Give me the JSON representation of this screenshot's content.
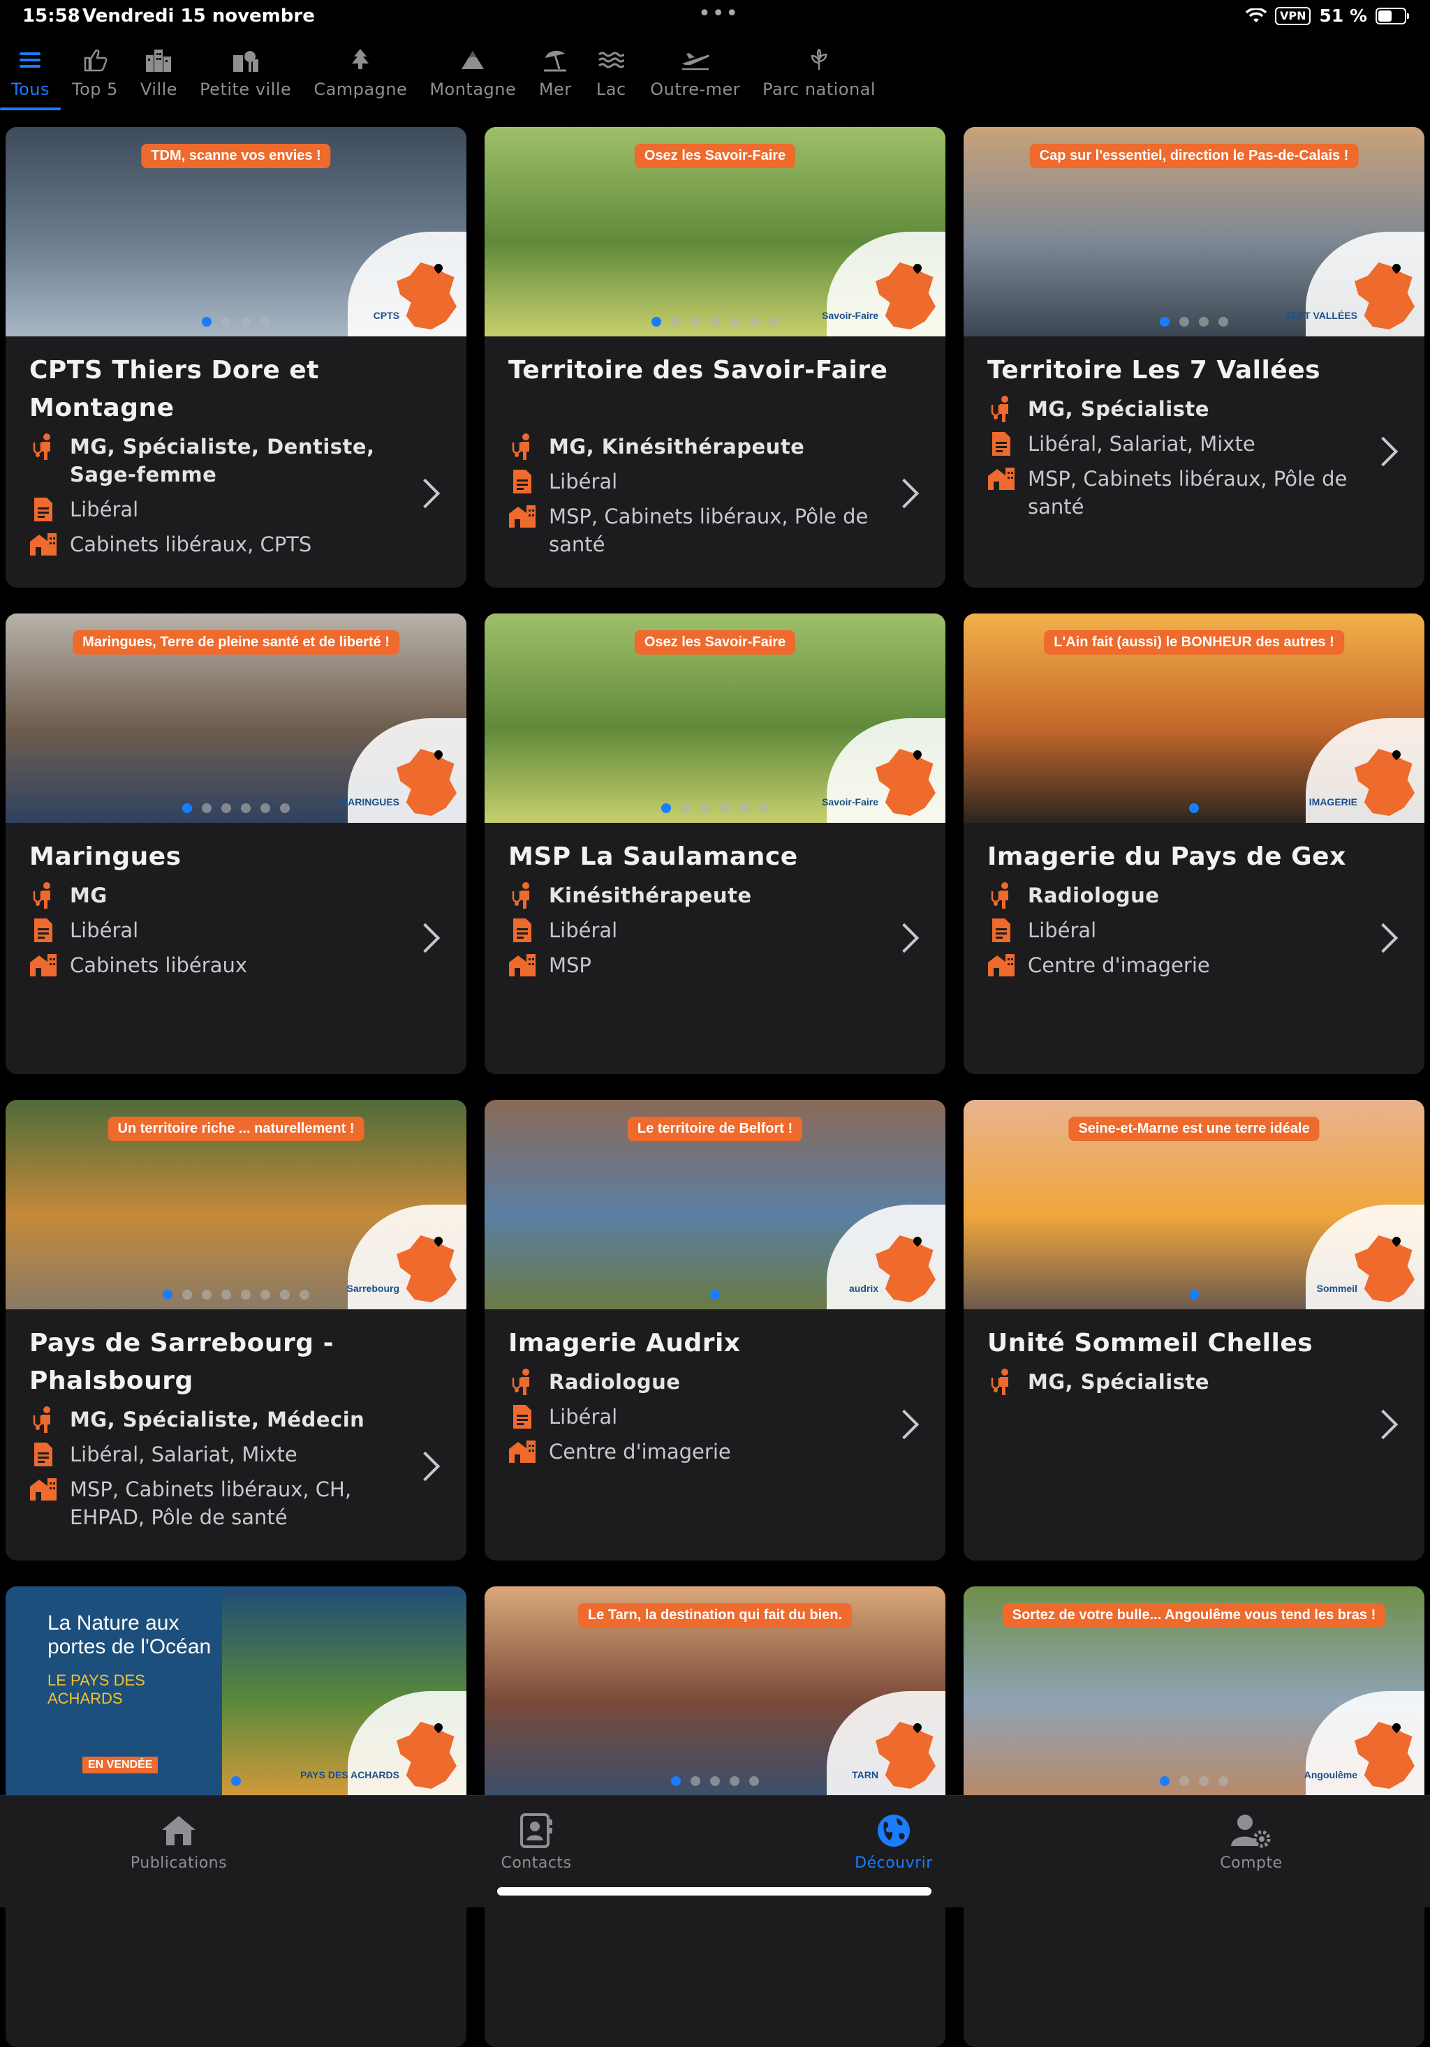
{
  "status": {
    "time": "15:58",
    "date": "Vendredi 15 novembre",
    "vpn": "VPN",
    "battery": "51 %"
  },
  "categories": [
    {
      "label": "Tous",
      "icon": "menu-icon",
      "active": true
    },
    {
      "label": "Top 5",
      "icon": "thumbs-up-icon"
    },
    {
      "label": "Ville",
      "icon": "city-icon"
    },
    {
      "label": "Petite ville",
      "icon": "small-town-icon"
    },
    {
      "label": "Campagne",
      "icon": "tree-icon"
    },
    {
      "label": "Montagne",
      "icon": "mountain-icon"
    },
    {
      "label": "Mer",
      "icon": "beach-umbrella-icon"
    },
    {
      "label": "Lac",
      "icon": "waves-icon"
    },
    {
      "label": "Outre-mer",
      "icon": "plane-icon"
    },
    {
      "label": "Parc national",
      "icon": "plant-icon"
    }
  ],
  "cards": [
    {
      "banner": "TDM, scanne vos envies !",
      "logo": "CPTS",
      "dots": 4,
      "active_dot": 0,
      "title": "CPTS Thiers Dore et Montagne",
      "specialties": "MG, Spécialiste, Dentiste, Sage-femme",
      "practice": "Libéral",
      "structures": "Cabinets libéraux, CPTS",
      "colors": [
        "#3d4a5a",
        "#6b7d8f",
        "#a8b6c4"
      ]
    },
    {
      "banner": "Osez les Savoir-Faire",
      "logo": "Savoir-Faire",
      "dots": 7,
      "active_dot": 0,
      "title": "Territoire des Savoir-Faire",
      "specialties": "MG, Kinésithérapeute",
      "practice": "Libéral",
      "structures": "MSP, Cabinets libéraux, Pôle de santé",
      "colors": [
        "#9fbf6a",
        "#5f8a3a",
        "#c7cf6d"
      ]
    },
    {
      "banner": "Cap sur l'essentiel, direction le Pas-de-Calais !",
      "logo": "SEPT VALLÉES",
      "dots": 4,
      "active_dot": 0,
      "title": "Territoire Les 7 Vallées",
      "specialties": "MG, Spécialiste",
      "practice": "Libéral, Salariat, Mixte",
      "structures": "MSP, Cabinets libéraux, Pôle de santé",
      "colors": [
        "#c9a27a",
        "#7d8894",
        "#3a4652"
      ]
    },
    {
      "banner": "Maringues, Terre de pleine santé et de liberté !",
      "logo": "MARINGUES",
      "dots": 6,
      "active_dot": 0,
      "title": "Maringues",
      "specialties": "MG",
      "practice": "Libéral",
      "structures": "Cabinets libéraux",
      "colors": [
        "#b8b3ab",
        "#6e5d4e",
        "#2f4260"
      ]
    },
    {
      "banner": "Osez les Savoir-Faire",
      "logo": "Savoir-Faire",
      "dots": 6,
      "active_dot": 0,
      "title": "MSP La Saulamance",
      "specialties": "Kinésithérapeute",
      "practice": "Libéral",
      "structures": "MSP",
      "colors": [
        "#9fbf6a",
        "#5f8a3a",
        "#c7cf6d"
      ]
    },
    {
      "banner": "L'Ain fait (aussi) le BONHEUR des autres !",
      "logo": "IMAGERIE",
      "dots": 1,
      "active_dot": 0,
      "title": "Imagerie du Pays de Gex",
      "specialties": "Radiologue",
      "practice": "Libéral",
      "structures": "Centre d'imagerie",
      "colors": [
        "#f2b14a",
        "#c4672a",
        "#2b2620"
      ]
    },
    {
      "banner": "Un territoire riche ... naturellement !",
      "logo": "Sarrebourg",
      "dots": 8,
      "active_dot": 0,
      "title": "Pays de Sarrebourg - Phalsbourg",
      "specialties": "MG, Spécialiste, Médecin",
      "practice": "Libéral, Salariat, Mixte",
      "structures": "MSP, Cabinets libéraux, CH, EHPAD, Pôle de santé",
      "colors": [
        "#4f6b3a",
        "#c48a3a",
        "#8a7a66"
      ]
    },
    {
      "banner": "Le territoire de Belfort !",
      "logo": "audrix",
      "dots": 1,
      "active_dot": 0,
      "title": "Imagerie Audrix",
      "specialties": "Radiologue",
      "practice": "Libéral",
      "structures": "Centre d'imagerie",
      "colors": [
        "#8a6a58",
        "#5b7fa3",
        "#6b7a46"
      ]
    },
    {
      "banner": "Seine-et-Marne est une terre idéale",
      "logo": "Sommeil",
      "dots": 1,
      "active_dot": 0,
      "title": "Unité Sommeil Chelles",
      "specialties": "MG, Spécialiste",
      "practice": "",
      "structures": "",
      "colors": [
        "#e8b38f",
        "#f0a63c",
        "#6d5a4e"
      ]
    },
    {
      "banner": "",
      "logo": "PAYS DES ACHARDS",
      "dots": 1,
      "active_dot": 0,
      "title": "",
      "specialties": "",
      "practice": "",
      "structures": "",
      "colors": [
        "#1f4b78",
        "#5a8a3a",
        "#d19a3a"
      ],
      "promo": {
        "line1": "La Nature aux",
        "line2": "portes de l'Océan",
        "line3": "LE PAYS DES ACHARDS",
        "badge": "EN VENDÉE"
      }
    },
    {
      "banner": "Le Tarn, la destination qui fait du bien.",
      "logo": "TARN",
      "dots": 5,
      "active_dot": 0,
      "title": "",
      "specialties": "",
      "practice": "",
      "structures": "",
      "colors": [
        "#d9a87a",
        "#7a4a3a",
        "#3b4f6b"
      ]
    },
    {
      "banner": "Sortez de votre bulle... Angoulême vous tend les bras !",
      "logo": "Angoulême",
      "dots": 4,
      "active_dot": 0,
      "title": "",
      "specialties": "",
      "practice": "",
      "structures": "",
      "colors": [
        "#6f8f4a",
        "#8fa3b5",
        "#b88a6a"
      ]
    }
  ],
  "tabbar": [
    {
      "label": "Publications",
      "icon": "home-icon"
    },
    {
      "label": "Contacts",
      "icon": "contacts-icon"
    },
    {
      "label": "Découvrir",
      "icon": "globe-icon",
      "active": true
    },
    {
      "label": "Compte",
      "icon": "account-settings-icon"
    }
  ]
}
